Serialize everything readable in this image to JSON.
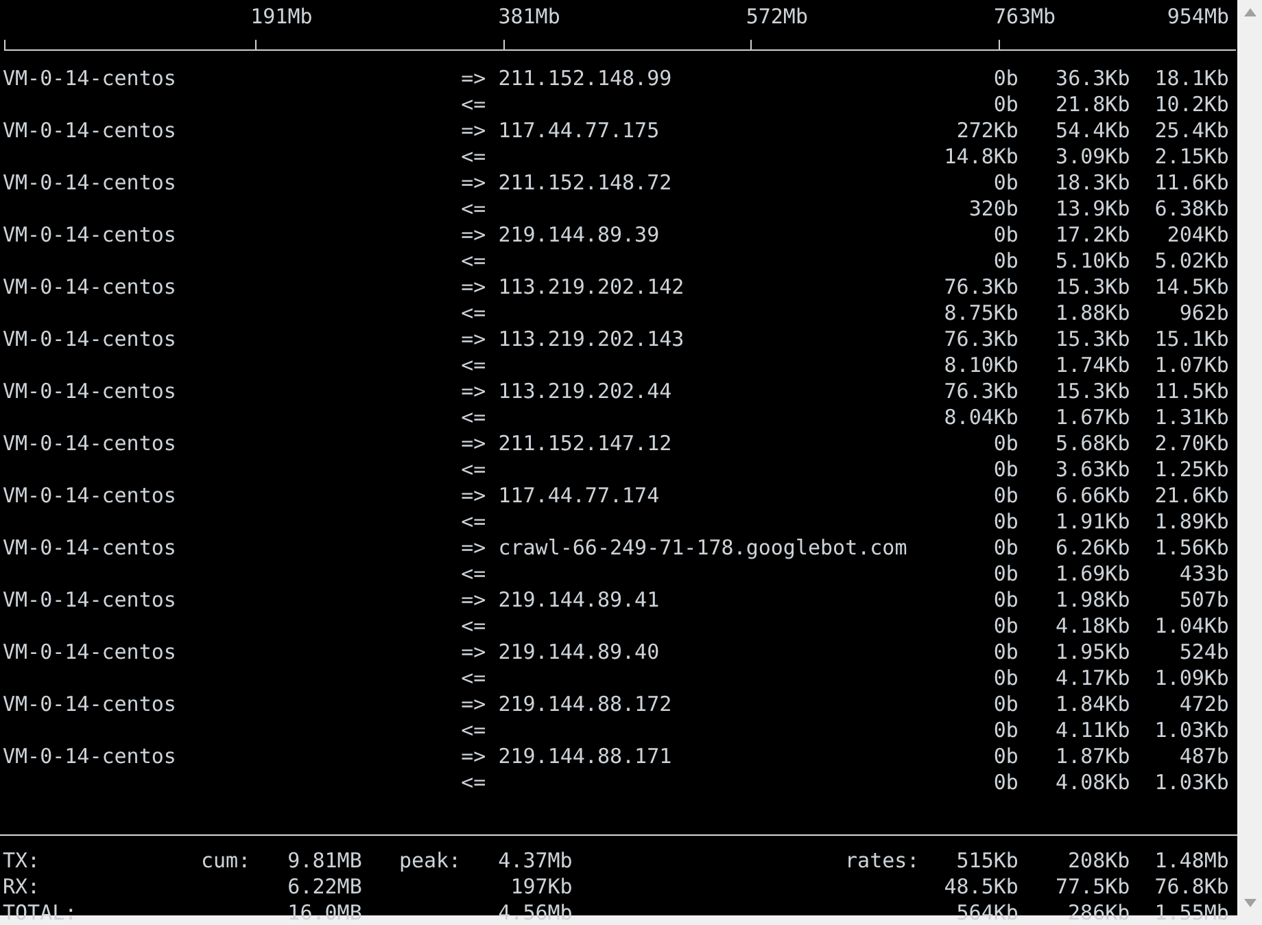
{
  "scale": {
    "labels": [
      "191Mb",
      "381Mb",
      "572Mb",
      "763Mb",
      "954Mb"
    ]
  },
  "flows": [
    {
      "host": "VM-0-14-centos",
      "remote": "211.152.148.99",
      "out": {
        "direction": "=>",
        "rates": [
          "0b",
          "36.3Kb",
          "18.1Kb"
        ]
      },
      "in": {
        "direction": "<=",
        "rates": [
          "0b",
          "21.8Kb",
          "10.2Kb"
        ]
      }
    },
    {
      "host": "VM-0-14-centos",
      "remote": "117.44.77.175",
      "out": {
        "direction": "=>",
        "rates": [
          "272Kb",
          "54.4Kb",
          "25.4Kb"
        ]
      },
      "in": {
        "direction": "<=",
        "rates": [
          "14.8Kb",
          "3.09Kb",
          "2.15Kb"
        ]
      }
    },
    {
      "host": "VM-0-14-centos",
      "remote": "211.152.148.72",
      "out": {
        "direction": "=>",
        "rates": [
          "0b",
          "18.3Kb",
          "11.6Kb"
        ]
      },
      "in": {
        "direction": "<=",
        "rates": [
          "320b",
          "13.9Kb",
          "6.38Kb"
        ]
      }
    },
    {
      "host": "VM-0-14-centos",
      "remote": "219.144.89.39",
      "out": {
        "direction": "=>",
        "rates": [
          "0b",
          "17.2Kb",
          "204Kb"
        ]
      },
      "in": {
        "direction": "<=",
        "rates": [
          "0b",
          "5.10Kb",
          "5.02Kb"
        ]
      }
    },
    {
      "host": "VM-0-14-centos",
      "remote": "113.219.202.142",
      "out": {
        "direction": "=>",
        "rates": [
          "76.3Kb",
          "15.3Kb",
          "14.5Kb"
        ]
      },
      "in": {
        "direction": "<=",
        "rates": [
          "8.75Kb",
          "1.88Kb",
          "962b"
        ]
      }
    },
    {
      "host": "VM-0-14-centos",
      "remote": "113.219.202.143",
      "out": {
        "direction": "=>",
        "rates": [
          "76.3Kb",
          "15.3Kb",
          "15.1Kb"
        ]
      },
      "in": {
        "direction": "<=",
        "rates": [
          "8.10Kb",
          "1.74Kb",
          "1.07Kb"
        ]
      }
    },
    {
      "host": "VM-0-14-centos",
      "remote": "113.219.202.44",
      "out": {
        "direction": "=>",
        "rates": [
          "76.3Kb",
          "15.3Kb",
          "11.5Kb"
        ]
      },
      "in": {
        "direction": "<=",
        "rates": [
          "8.04Kb",
          "1.67Kb",
          "1.31Kb"
        ]
      }
    },
    {
      "host": "VM-0-14-centos",
      "remote": "211.152.147.12",
      "out": {
        "direction": "=>",
        "rates": [
          "0b",
          "5.68Kb",
          "2.70Kb"
        ]
      },
      "in": {
        "direction": "<=",
        "rates": [
          "0b",
          "3.63Kb",
          "1.25Kb"
        ]
      }
    },
    {
      "host": "VM-0-14-centos",
      "remote": "117.44.77.174",
      "out": {
        "direction": "=>",
        "rates": [
          "0b",
          "6.66Kb",
          "21.6Kb"
        ]
      },
      "in": {
        "direction": "<=",
        "rates": [
          "0b",
          "1.91Kb",
          "1.89Kb"
        ]
      }
    },
    {
      "host": "VM-0-14-centos",
      "remote": "crawl-66-249-71-178.googlebot.com",
      "out": {
        "direction": "=>",
        "rates": [
          "0b",
          "6.26Kb",
          "1.56Kb"
        ]
      },
      "in": {
        "direction": "<=",
        "rates": [
          "0b",
          "1.69Kb",
          "433b"
        ]
      }
    },
    {
      "host": "VM-0-14-centos",
      "remote": "219.144.89.41",
      "out": {
        "direction": "=>",
        "rates": [
          "0b",
          "1.98Kb",
          "507b"
        ]
      },
      "in": {
        "direction": "<=",
        "rates": [
          "0b",
          "4.18Kb",
          "1.04Kb"
        ]
      }
    },
    {
      "host": "VM-0-14-centos",
      "remote": "219.144.89.40",
      "out": {
        "direction": "=>",
        "rates": [
          "0b",
          "1.95Kb",
          "524b"
        ]
      },
      "in": {
        "direction": "<=",
        "rates": [
          "0b",
          "4.17Kb",
          "1.09Kb"
        ]
      }
    },
    {
      "host": "VM-0-14-centos",
      "remote": "219.144.88.172",
      "out": {
        "direction": "=>",
        "rates": [
          "0b",
          "1.84Kb",
          "472b"
        ]
      },
      "in": {
        "direction": "<=",
        "rates": [
          "0b",
          "4.11Kb",
          "1.03Kb"
        ]
      }
    },
    {
      "host": "VM-0-14-centos",
      "remote": "219.144.88.171",
      "out": {
        "direction": "=>",
        "rates": [
          "0b",
          "1.87Kb",
          "487b"
        ]
      },
      "in": {
        "direction": "<=",
        "rates": [
          "0b",
          "4.08Kb",
          "1.03Kb"
        ]
      }
    }
  ],
  "totals": [
    {
      "label": "TX:",
      "cum_label": "cum:",
      "cum": "9.81MB",
      "peak_label": "peak:",
      "peak": "4.37Mb",
      "rates_label": "rates:",
      "rates": [
        "515Kb",
        "208Kb",
        "1.48Mb"
      ]
    },
    {
      "label": "RX:",
      "cum": "6.22MB",
      "peak": "197Kb",
      "rates": [
        "48.5Kb",
        "77.5Kb",
        "76.8Kb"
      ]
    },
    {
      "label": "TOTAL:",
      "cum": "16.0MB",
      "peak": "4.56Mb",
      "rates": [
        "564Kb",
        "286Kb",
        "1.55Mb"
      ]
    }
  ]
}
